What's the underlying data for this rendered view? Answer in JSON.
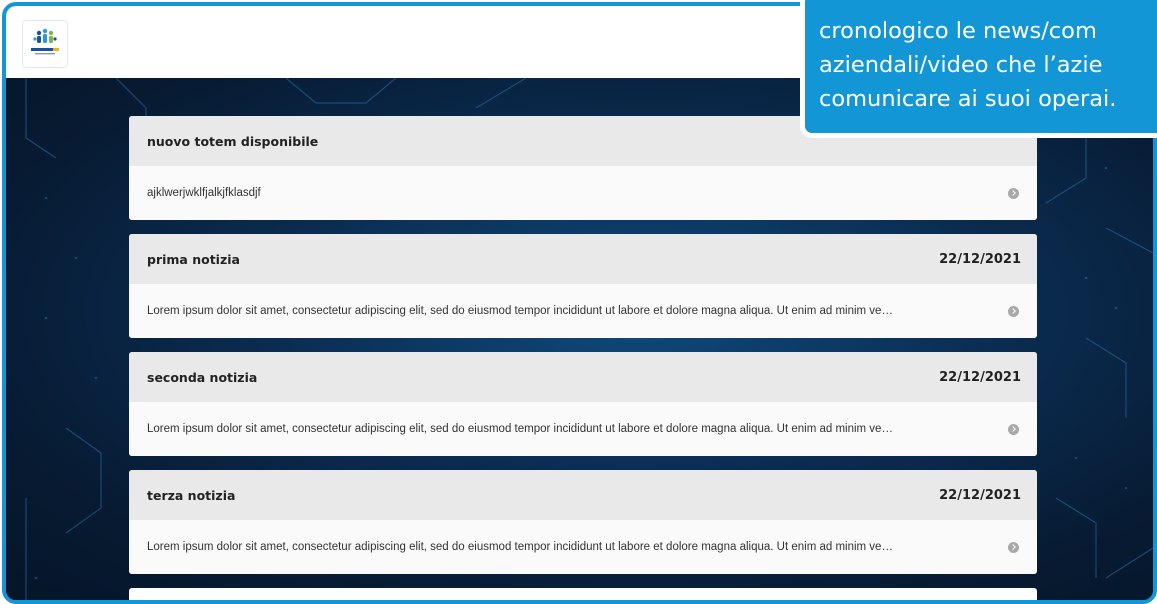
{
  "header": {
    "logo": "company-logo"
  },
  "news": [
    {
      "title": "nuovo totem disponibile",
      "date": "",
      "preview": "ajklwerjwklfjalkjfklasdjf"
    },
    {
      "title": "prima notizia",
      "date": "22/12/2021",
      "preview": "Lorem ipsum dolor sit amet, consectetur adipiscing elit, sed do eiusmod tempor incididunt ut labore et dolore magna aliqua. Ut enim ad minim ve…"
    },
    {
      "title": "seconda notizia",
      "date": "22/12/2021",
      "preview": "Lorem ipsum dolor sit amet, consectetur adipiscing elit, sed do eiusmod tempor incididunt ut labore et dolore magna aliqua. Ut enim ad minim ve…"
    },
    {
      "title": "terza notizia",
      "date": "22/12/2021",
      "preview": "Lorem ipsum dolor sit amet, consectetur adipiscing elit, sed do eiusmod tempor incididunt ut labore et dolore magna aliqua. Ut enim ad minim ve…"
    }
  ],
  "callout": {
    "line1": "cronologico le news/com",
    "line2": "aziendali/video che l’azie",
    "line3": "comunicare ai suoi operai."
  },
  "colors": {
    "accent": "#1296d6",
    "background_dark": "#0c2341",
    "card_header": "#e9e9e9"
  },
  "icons": {
    "card_action": "chevron-right-circle-icon"
  }
}
